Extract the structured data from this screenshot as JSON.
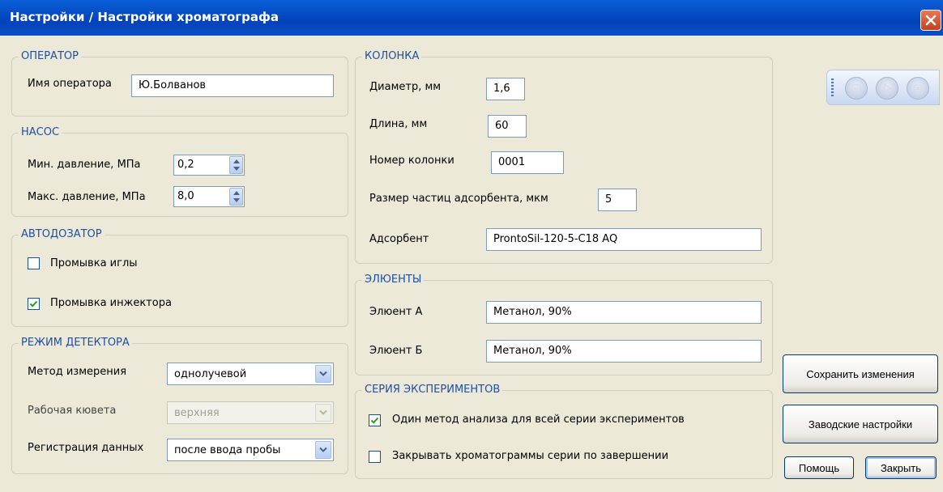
{
  "window": {
    "title": "Настройки / Настройки хроматографа"
  },
  "operator": {
    "legend": "ОПЕРАТОР",
    "name_label": "Имя оператора",
    "name_value": "Ю.Болванов"
  },
  "pump": {
    "legend": "НАСОС",
    "min_label": "Мин. давление, МПа",
    "min_value": "0,2",
    "max_label": "Макс. давление, МПа",
    "max_value": "8,0"
  },
  "autosampler": {
    "legend": "АВТОДОЗАТОР",
    "needle_wash": {
      "label": "Промывка иглы",
      "checked": false
    },
    "injector_wash": {
      "label": "Промывка инжектора",
      "checked": true
    }
  },
  "detector": {
    "legend": "РЕЖИМ ДЕТЕКТОРА",
    "method_label": "Метод измерения",
    "method_value": "однолучевой",
    "cuvette_label": "Рабочая кювета",
    "cuvette_value": "верхняя",
    "registration_label": "Регистрация данных",
    "registration_value": "после ввода пробы"
  },
  "column": {
    "legend": "КОЛОНКА",
    "diameter_label": "Диаметр, мм",
    "diameter_value": "1,6",
    "length_label": "Длина, мм",
    "length_value": "60",
    "number_label": "Номер колонки",
    "number_value": "0001",
    "particle_label": "Размер частиц адсорбента, мкм",
    "particle_value": "5",
    "adsorbent_label": "Адсорбент",
    "adsorbent_value": "ProntoSil-120-5-C18 AQ"
  },
  "eluents": {
    "legend": "ЭЛЮЕНТЫ",
    "a_label": "Элюент А",
    "a_value": "Метанол, 90%",
    "b_label": "Элюент Б",
    "b_value": "Метанол, 90%"
  },
  "series": {
    "legend": "СЕРИЯ ЭКСПЕРИМЕНТОВ",
    "one_method": {
      "label": "Один метод анализа для всей серии экспериментов",
      "checked": true
    },
    "close_chromatograms": {
      "label": "Закрывать хроматограммы серии по завершении",
      "checked": false
    }
  },
  "buttons": {
    "save": "Сохранить изменения",
    "factory": "Заводские настройки",
    "help": "Помощь",
    "close": "Закрыть"
  },
  "toolbar": {
    "icons": [
      "pause-icon",
      "play-icon",
      "stop-icon"
    ]
  },
  "colors": {
    "title_bar": "#0342b8",
    "group_legend": "#1d4fa9",
    "background": "#ece9d8",
    "close_button": "#d45434"
  }
}
